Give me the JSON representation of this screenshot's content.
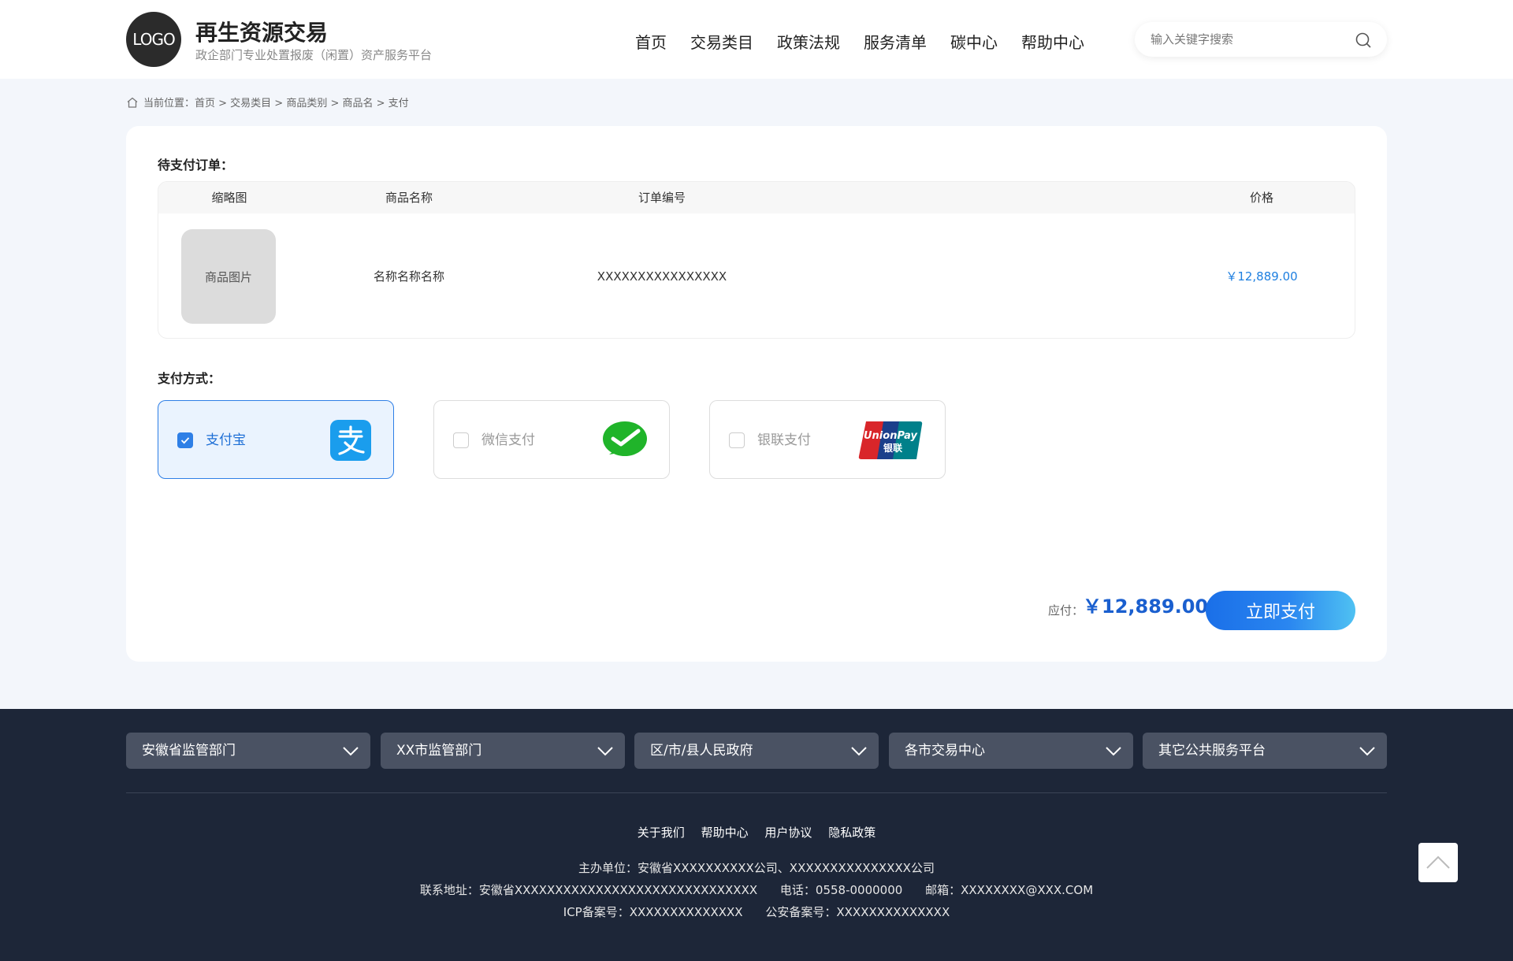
{
  "header": {
    "logo_text": "LOGO",
    "title": "再生资源交易",
    "subtitle": "政企部门专业处置报废（闲置）资产服务平台",
    "nav": [
      "首页",
      "交易类目",
      "政策法规",
      "服务清单",
      "碳中心",
      "帮助中心"
    ],
    "search_placeholder": "输入关键字搜索"
  },
  "breadcrumb": {
    "prefix": "当前位置：",
    "path": "首页 > 交易类目 > 商品类别 > 商品名 > 支付"
  },
  "order": {
    "section_title": "待支付订单：",
    "columns": [
      "缩略图",
      "商品名称",
      "订单编号",
      "价格"
    ],
    "rows": [
      {
        "thumbnail": "商品图片",
        "name": "名称名称名称",
        "order_no": "XXXXXXXXXXXXXXXX",
        "price": "￥12,889.00"
      }
    ]
  },
  "payment": {
    "section_title": "支付方式：",
    "methods": [
      {
        "label": "支付宝",
        "selected": true
      },
      {
        "label": "微信支付",
        "selected": false
      },
      {
        "label": "银联支付",
        "selected": false
      }
    ],
    "unionpay_logo_text": "UnionPay",
    "unionpay_logo_cn": "银联",
    "due_label": "应付：",
    "due_amount": "￥12,889.00",
    "pay_button": "立即支付"
  },
  "footer": {
    "selects": [
      "安徽省监管部门",
      "XX市监管部门",
      "区/市/县人民政府",
      "各市交易中心",
      "其它公共服务平台"
    ],
    "links": [
      "关于我们",
      "帮助中心",
      "用户协议",
      "隐私政策"
    ],
    "organizer": "主办单位：安徽省XXXXXXXXXX公司、XXXXXXXXXXXXXXX公司",
    "address": "联系地址：安徽省XXXXXXXXXXXXXXXXXXXXXXXXXXXXXX",
    "phone": "电话：0558-0000000",
    "email": "邮箱：XXXXXXXX@XXX.COM",
    "icp": "ICP备案号：XXXXXXXXXXXXXX",
    "police": "公安备案号：XXXXXXXXXXXXXX"
  },
  "colors": {
    "accent": "#2e7fe6",
    "price": "#1e7fe0",
    "footer_bg": "#1d2638",
    "alipay": "#1a9ded",
    "wechat": "#20b42a"
  }
}
